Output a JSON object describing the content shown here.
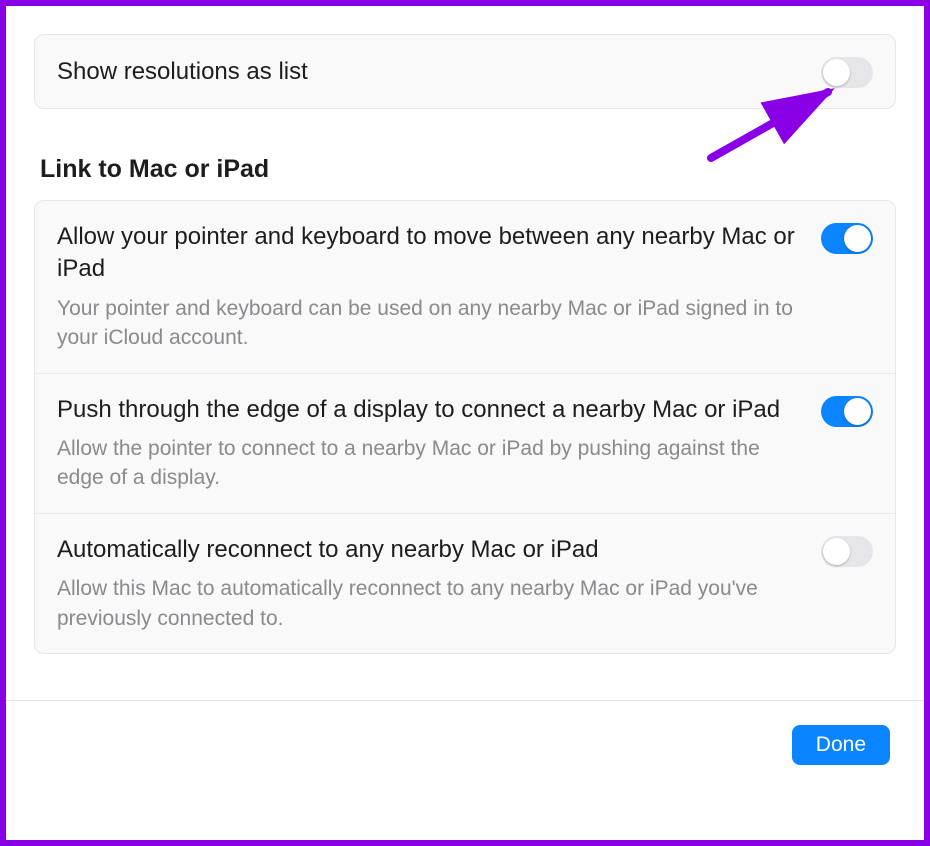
{
  "top": {
    "show_resolutions_label": "Show resolutions as list",
    "show_resolutions_on": false
  },
  "link_section": {
    "title": "Link to Mac or iPad",
    "items": [
      {
        "title": "Allow your pointer and keyboard to move between any nearby Mac or iPad",
        "desc": "Your pointer and keyboard can be used on any nearby Mac or iPad signed in to your iCloud account.",
        "on": true
      },
      {
        "title": "Push through the edge of a display to connect a nearby Mac or iPad",
        "desc": "Allow the pointer to connect to a nearby Mac or iPad by pushing against the edge of a display.",
        "on": true
      },
      {
        "title": "Automatically reconnect to any nearby Mac or iPad",
        "desc": "Allow this Mac to automatically reconnect to any nearby Mac or iPad you've previously connected to.",
        "on": false
      }
    ]
  },
  "footer": {
    "done_label": "Done"
  },
  "annotation": {
    "arrow_target": "show-resolutions-toggle",
    "arrow_color": "#8a00e6"
  }
}
